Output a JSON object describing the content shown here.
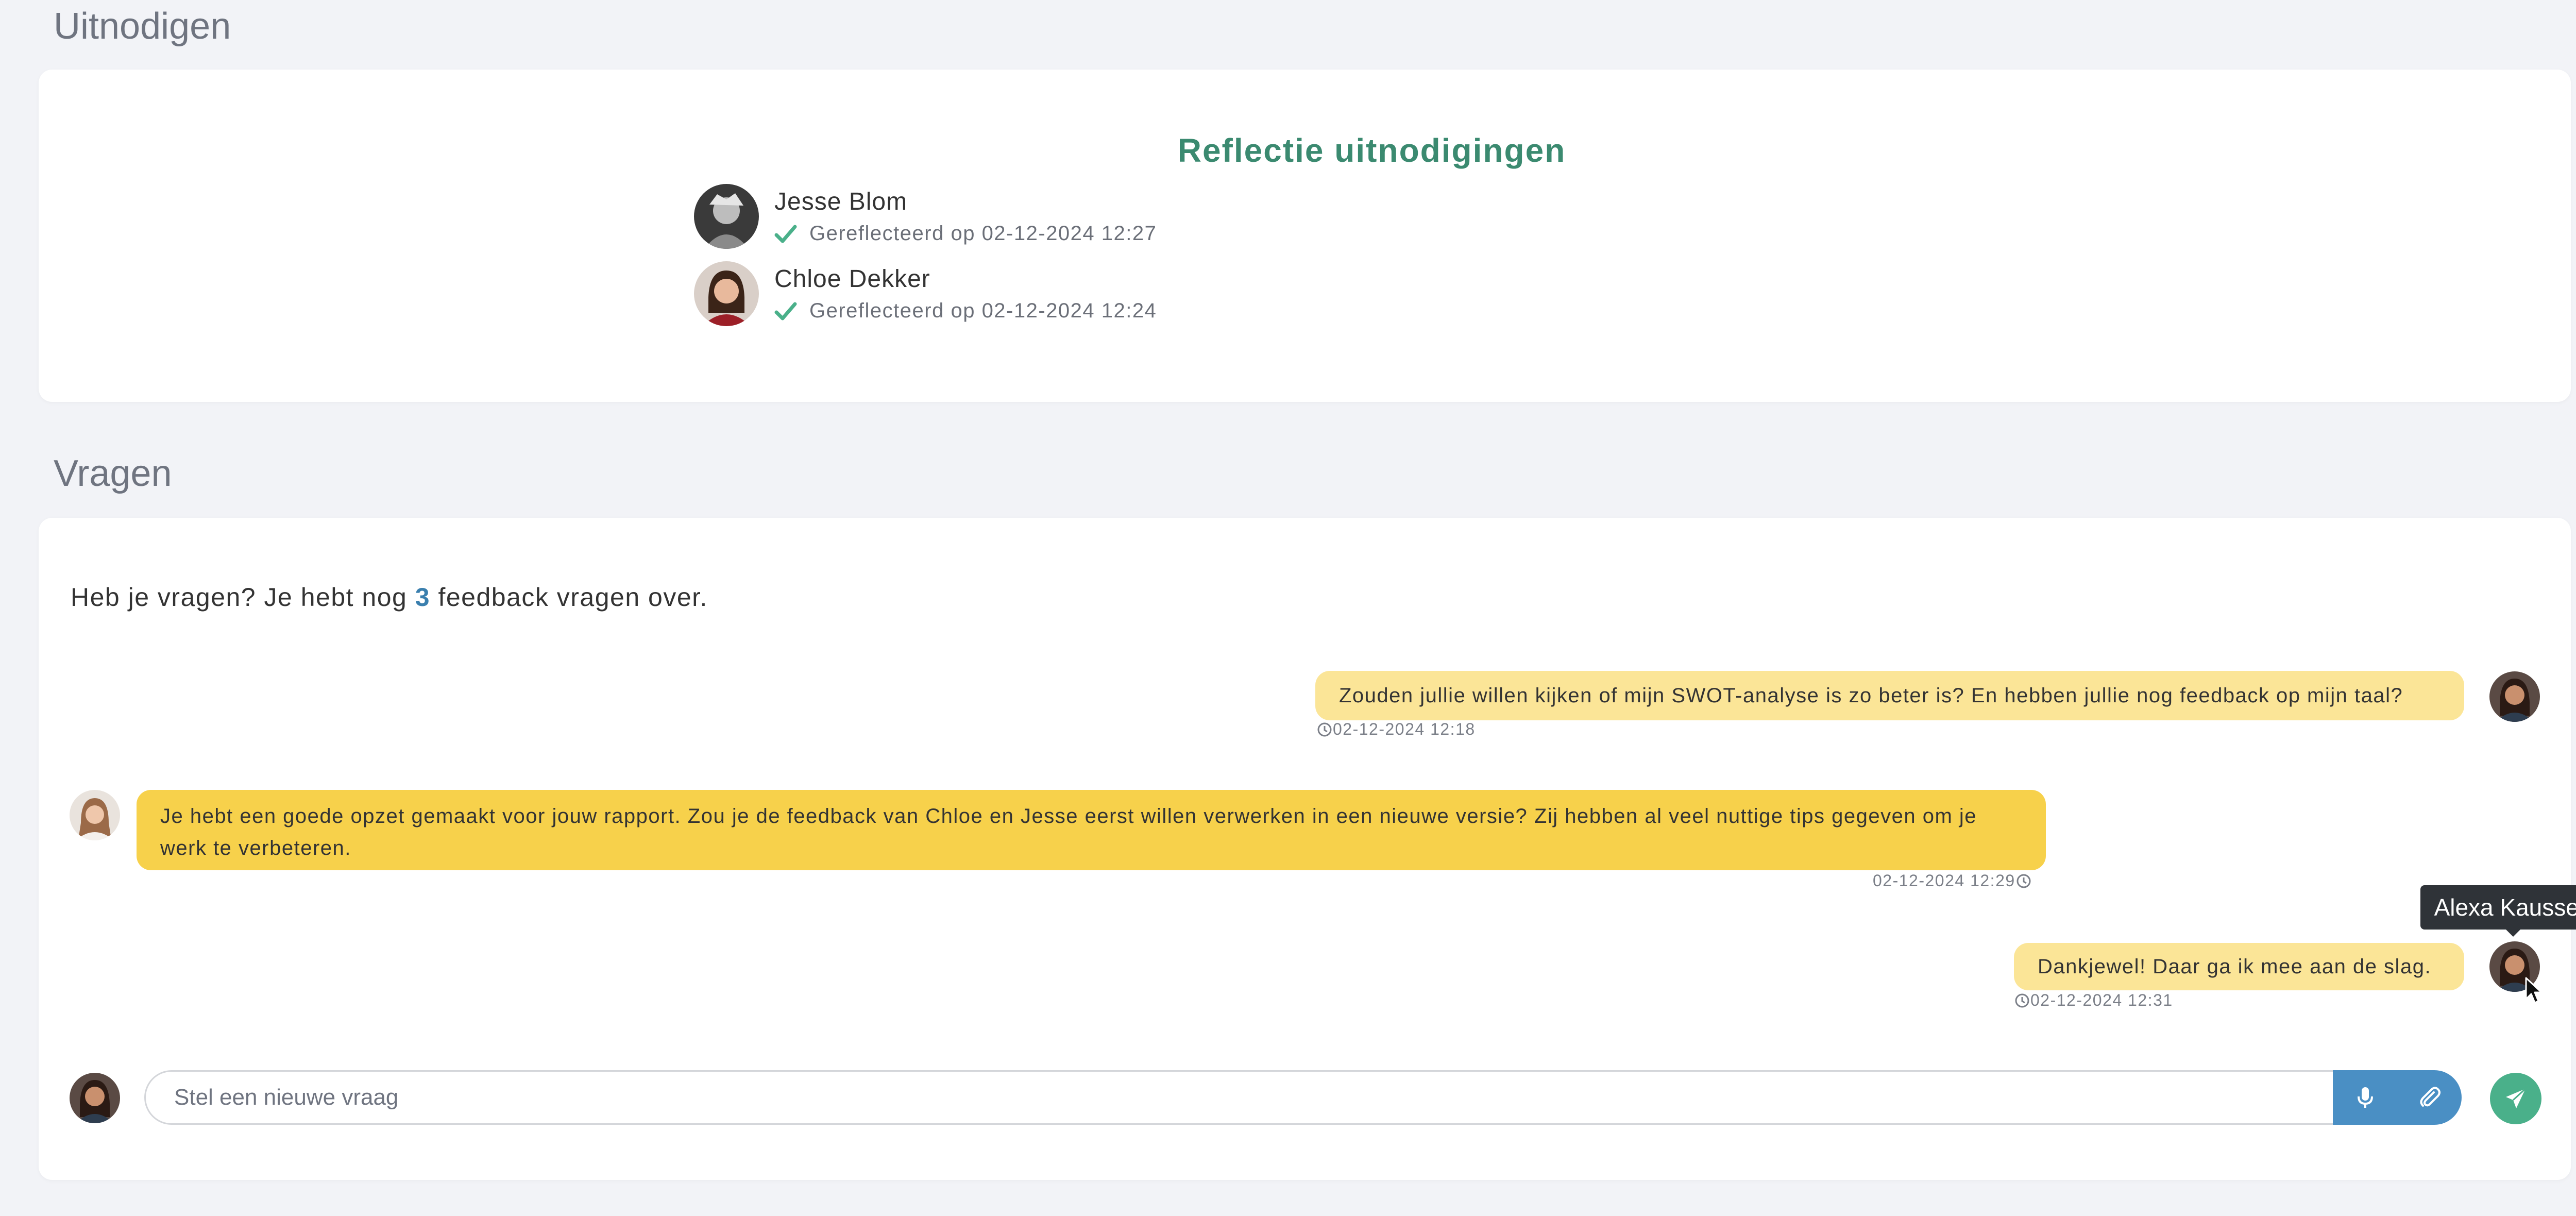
{
  "sections": {
    "invites_title": "Uitnodigen",
    "questions_title": "Vragen"
  },
  "invites": {
    "heading": "Reflectie uitnodigingen",
    "people": [
      {
        "name": "Jesse Blom",
        "status": "Gereflecteerd op 02-12-2024 12:27"
      },
      {
        "name": "Chloe Dekker",
        "status": "Gereflecteerd op 02-12-2024 12:24"
      }
    ]
  },
  "questions": {
    "intro_before": "Heb je vragen? Je hebt nog ",
    "intro_count": "3",
    "intro_after": " feedback vragen over.",
    "messages": [
      {
        "text": "Zouden jullie willen kijken of mijn SWOT-analyse is zo beter is? En hebben jullie nog feedback op mijn taal?",
        "time": "02-12-2024 12:18"
      },
      {
        "text": "Je hebt een goede opzet gemaakt voor jouw rapport. Zou je de feedback van Chloe en Jesse eerst willen verwerken in een nieuwe versie? Zij hebben al veel nuttige tips gegeven om je werk te verbeteren.",
        "time": "02-12-2024 12:29"
      },
      {
        "text": "Dankjewel! Daar ga ik mee aan de slag.",
        "time": "02-12-2024 12:31"
      }
    ],
    "tooltip": "Alexa Kaussen",
    "input_placeholder": "Stel een nieuwe vraag"
  },
  "colors": {
    "accent_green": "#3b8a70",
    "count_blue": "#3a7fae",
    "bubble_own": "#fbe597",
    "bubble_other": "#f7d14b",
    "button_blue": "#4a8fc4",
    "send_green": "#4ab08a"
  },
  "icons": [
    "check-icon",
    "clock-icon",
    "microphone-icon",
    "paperclip-icon",
    "send-icon",
    "cursor-icon"
  ]
}
